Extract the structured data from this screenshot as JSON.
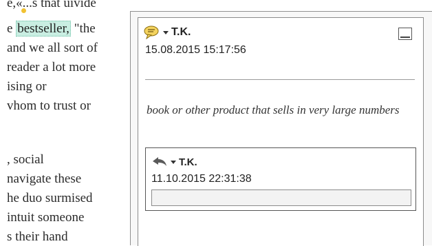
{
  "document": {
    "lines": [
      "e,«...s tnat uivide",
      "e",
      "and we all sort of",
      "reader a lot more",
      "ising or",
      "vhom to trust or",
      ", social",
      "navigate these",
      "he duo surmised",
      "intuit someone",
      "s their hand"
    ],
    "highlight": "bestseller,",
    "after_highlight": " \"the"
  },
  "comment": {
    "author": "T.K.",
    "timestamp": "15.08.2015 15:17:56",
    "text": "book or other product that sells in very large numbers",
    "reply": {
      "author": "T.K.",
      "timestamp": "11.10.2015 22:31:38",
      "input_value": ""
    }
  },
  "icons": {
    "note": "speech-bubble-icon",
    "reply": "reply-arrow-icon",
    "minimize": "minimize-icon"
  },
  "colors": {
    "highlight": "#c9eee2",
    "note_icon": "#f1c232"
  }
}
